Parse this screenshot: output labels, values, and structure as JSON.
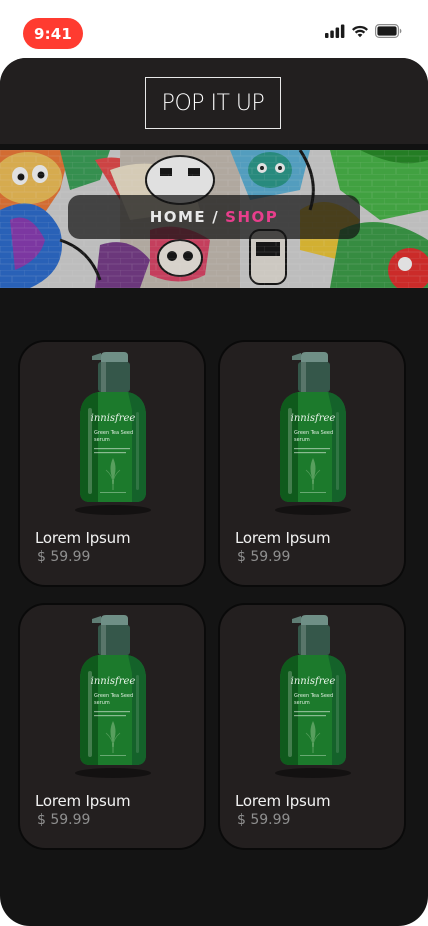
{
  "status_bar": {
    "time": "9:41",
    "icons": [
      "signal-icon",
      "wifi-icon",
      "battery-icon"
    ]
  },
  "header": {
    "logo_text": "POP IT UP"
  },
  "hero": {
    "breadcrumb_home": "HOME",
    "breadcrumb_separator": "/",
    "breadcrumb_current": "SHOP",
    "accent_color": "#e83e8c"
  },
  "products": [
    {
      "name": "Lorem Ipsum",
      "price": "$ 59.99",
      "image": "serum-bottle"
    },
    {
      "name": "Lorem Ipsum",
      "price": "$ 59.99",
      "image": "serum-bottle"
    },
    {
      "name": "Lorem Ipsum",
      "price": "$ 59.99",
      "image": "serum-bottle"
    },
    {
      "name": "Lorem Ipsum",
      "price": "$ 59.99",
      "image": "serum-bottle"
    }
  ],
  "bottle_label": {
    "brand": "innisfree",
    "line1": "Green Tea Seed",
    "line2": "serum"
  },
  "colors": {
    "background": "#141414",
    "header": "#221f1f",
    "card": "#231f1f",
    "status_pill": "#ff3b30",
    "bottle_green": "#1f7a2a"
  }
}
